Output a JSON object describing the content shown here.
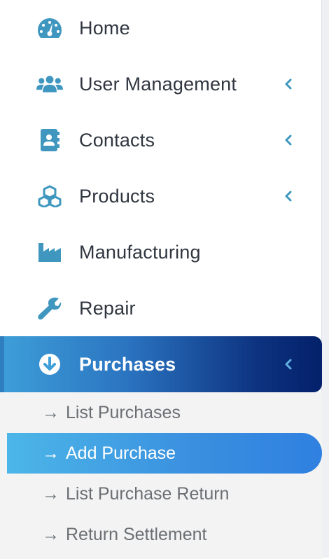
{
  "colors": {
    "icon": "#3f97bf",
    "text": "#2f3640",
    "active_gradient_start": "#3e9fd9",
    "active_gradient_end": "#04206a",
    "submenu_bg": "#f3f3f3",
    "submenu_text": "#6b6f74",
    "sub_active_start": "#4cb6e8",
    "sub_active_end": "#2f80e0"
  },
  "sidebar": {
    "items": [
      {
        "label": "Home",
        "icon": "dashboard-icon",
        "has_chevron": false
      },
      {
        "label": "User Management",
        "icon": "users-icon",
        "has_chevron": true
      },
      {
        "label": "Contacts",
        "icon": "address-book-icon",
        "has_chevron": true
      },
      {
        "label": "Products",
        "icon": "cubes-icon",
        "has_chevron": true
      },
      {
        "label": "Manufacturing",
        "icon": "industry-icon",
        "has_chevron": false
      },
      {
        "label": "Repair",
        "icon": "wrench-icon",
        "has_chevron": false
      },
      {
        "label": "Purchases",
        "icon": "arrow-circle-down-icon",
        "has_chevron": true,
        "active": true
      }
    ],
    "purchases_submenu": {
      "arrow": "→",
      "items": [
        {
          "label": "List Purchases"
        },
        {
          "label": "Add Purchase",
          "active": true
        },
        {
          "label": "List Purchase Return"
        },
        {
          "label": "Return Settlement"
        }
      ]
    }
  }
}
